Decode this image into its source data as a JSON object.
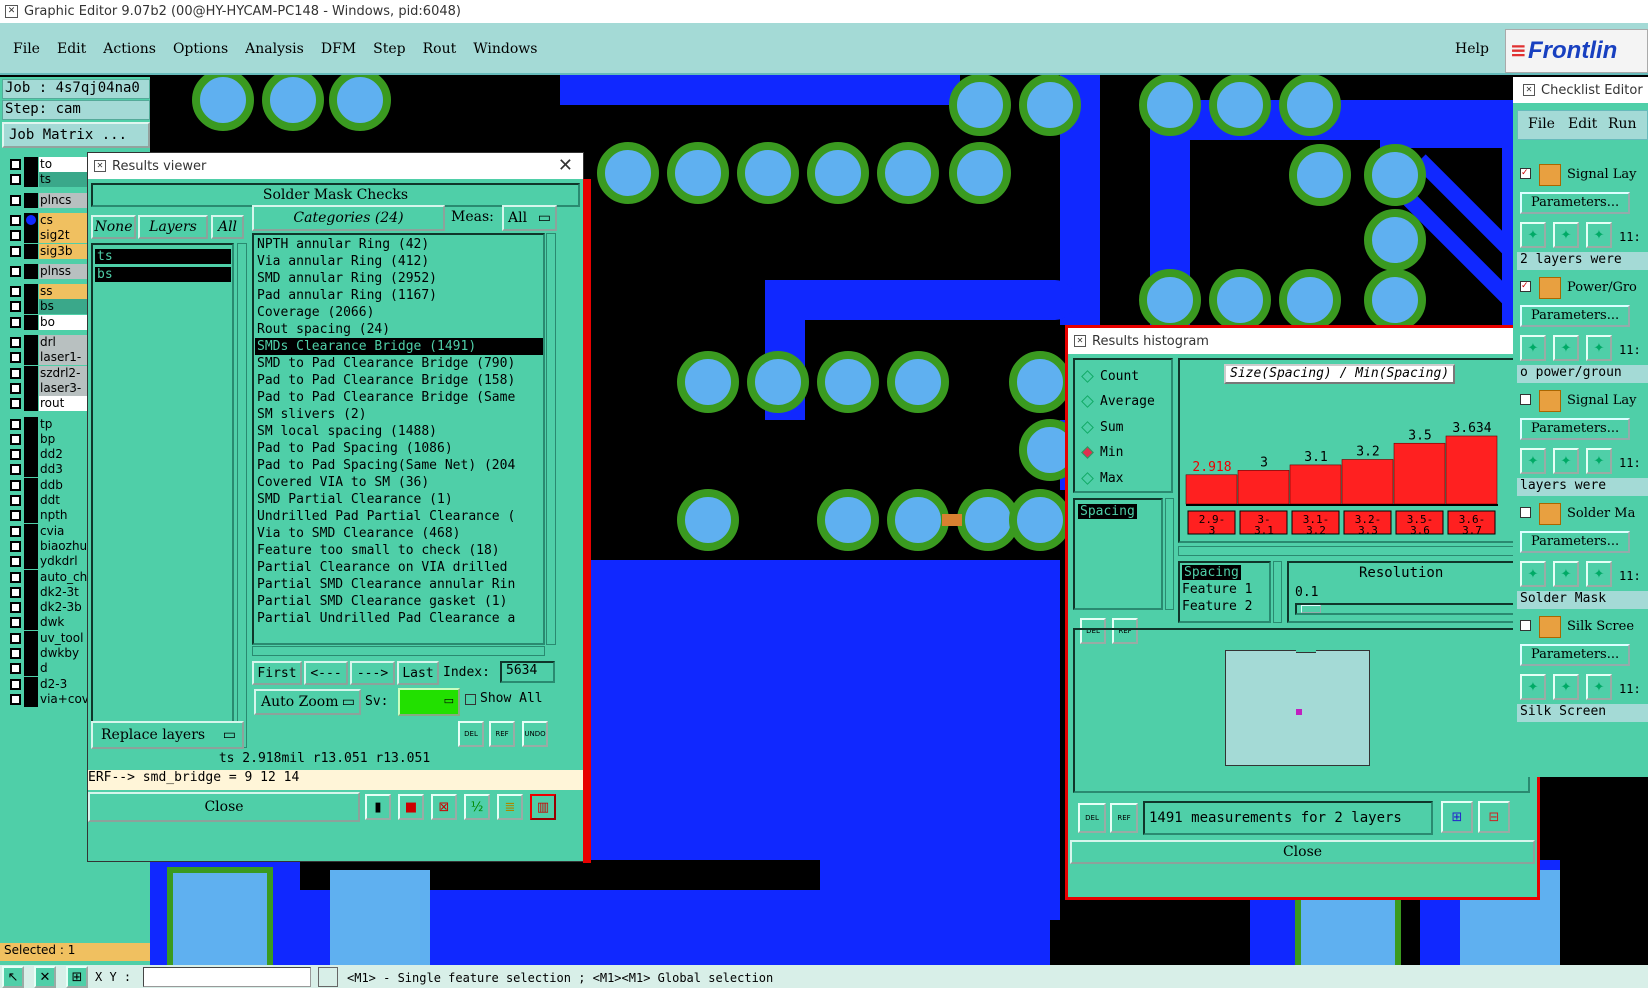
{
  "app": {
    "title": "Graphic Editor 9.07b2 (00@HY-HYCAM-PC148 - Windows, pid:6048)",
    "menu": [
      "File",
      "Edit",
      "Actions",
      "Options",
      "Analysis",
      "DFM",
      "Step",
      "Rout",
      "Windows"
    ],
    "help": "Help",
    "logo": "Frontlin"
  },
  "left_panel": {
    "job": "Job : 4s7qj04na0",
    "step": "Step: cam",
    "job_matrix": "Job Matrix ...",
    "selected": "Selected : 1",
    "xy_label": "X Y :",
    "layers": [
      {
        "name": "to",
        "bg": "#ffffff"
      },
      {
        "name": "ts",
        "bg": "#3aa88a"
      },
      {
        "name": "plncs",
        "bg": "#b8c0c0"
      },
      {
        "name": "cs",
        "bg": "#f0c060"
      },
      {
        "name": "sig2t",
        "bg": "#f0c060"
      },
      {
        "name": "sig3b",
        "bg": "#f0c060"
      },
      {
        "name": "plnss",
        "bg": "#b8c0c0"
      },
      {
        "name": "ss",
        "bg": "#f0c060"
      },
      {
        "name": "bs",
        "bg": "#3aa88a"
      },
      {
        "name": "bo",
        "bg": "#ffffff"
      },
      {
        "name": "drl",
        "bg": "#b8c0c0"
      },
      {
        "name": "laser1-",
        "bg": "#b8c0c0"
      },
      {
        "name": "szdrl2-",
        "bg": "#b8c0c0"
      },
      {
        "name": "laser3-",
        "bg": "#b8c0c0"
      },
      {
        "name": "rout",
        "bg": "#ffffff"
      },
      {
        "name": "tp",
        "bg": "#4fcfa8"
      },
      {
        "name": "bp",
        "bg": "#4fcfa8"
      },
      {
        "name": "dd2",
        "bg": "#4fcfa8"
      },
      {
        "name": "dd3",
        "bg": "#4fcfa8"
      },
      {
        "name": "ddb",
        "bg": "#4fcfa8"
      },
      {
        "name": "ddt",
        "bg": "#4fcfa8"
      },
      {
        "name": "npth",
        "bg": "#4fcfa8"
      },
      {
        "name": "cvia",
        "bg": "#4fcfa8"
      },
      {
        "name": "biaozhu",
        "bg": "#4fcfa8"
      },
      {
        "name": "ydkdrl",
        "bg": "#4fcfa8"
      },
      {
        "name": "auto_ch",
        "bg": "#4fcfa8"
      },
      {
        "name": "dk2-3t",
        "bg": "#4fcfa8"
      },
      {
        "name": "dk2-3b",
        "bg": "#4fcfa8"
      },
      {
        "name": "dwk",
        "bg": "#4fcfa8"
      },
      {
        "name": "uv_tool",
        "bg": "#4fcfa8"
      },
      {
        "name": "dwkby",
        "bg": "#4fcfa8"
      },
      {
        "name": "d",
        "bg": "#4fcfa8"
      },
      {
        "name": "d2-3",
        "bg": "#4fcfa8"
      },
      {
        "name": "via+cov",
        "bg": "#4fcfa8"
      }
    ]
  },
  "status_bar": {
    "text": "<M1> - Single feature selection ; <M1><M1> Global selection"
  },
  "results_viewer": {
    "title": "Results viewer",
    "heading": "Solder Mask Checks",
    "none_btn": "None",
    "layers_label": "Layers",
    "all_btn": "All",
    "layer_items": [
      "ts",
      "bs"
    ],
    "categories_label": "Categories (24)",
    "meas_label": "Meas:",
    "meas_value": "All",
    "categories": [
      "NPTH annular Ring (42)",
      "Via annular Ring (412)",
      "SMD annular Ring (2952)",
      "Pad annular Ring (1167)",
      "Coverage (2066)",
      "Rout spacing (24)",
      "SMDs Clearance Bridge (1491)",
      "SMD to Pad Clearance Bridge (790)",
      "Pad to Pad Clearance Bridge (158)",
      "Pad to Pad Clearance Bridge (Same",
      "SM slivers (2)",
      "SM local spacing (1488)",
      "Pad to Pad Spacing (1086)",
      "Pad to Pad Spacing(Same Net) (204",
      "Covered VIA to SM (36)",
      "SMD Partial Clearance (1)",
      "Undrilled Pad Partial Clearance (",
      "Via to SMD Clearance (468)",
      "Feature too small to check (18)",
      "Partial Clearance on VIA drilled",
      "Partial SMD Clearance annular Rin",
      "Partial SMD Clearance gasket (1)",
      "Partial Undrilled Pad Clearance a"
    ],
    "selected_category_index": 6,
    "first_btn": "First",
    "prev_btn": "<---",
    "next_btn": "--->",
    "last_btn": "Last",
    "index_label": "Index:",
    "index_value": "5634",
    "auto_zoom": "Auto Zoom",
    "sv_label": "Sv:",
    "show_all": "Show All",
    "replace_layers": "Replace layers",
    "info_line": "ts 2.918mil   r13.051   r13.051",
    "erf_line": "ERF--> smd_bridge = 9 12 14",
    "close": "Close"
  },
  "results_histogram": {
    "title": "Results histogram",
    "modes": [
      "Count",
      "Average",
      "Sum",
      "Min",
      "Max"
    ],
    "selected_mode": "Min",
    "list_item": "Spacing",
    "chart_title": "Size(Spacing) / Min(Spacing)",
    "attr_list": [
      "Spacing",
      "Feature 1",
      "Feature 2"
    ],
    "resolution_label": "Resolution",
    "resolution_value": "0.1",
    "summary": "1491 measurements for 2 layers",
    "close": "Close"
  },
  "chart_data": {
    "type": "bar",
    "title": "Size(Spacing) / Min(Spacing)",
    "categories": [
      "2.9-3",
      "3-3.1",
      "3.1-3.2",
      "3.2-3.3",
      "3.5-3.6",
      "3.6-3.7"
    ],
    "values": [
      2.918,
      3,
      3.1,
      3.2,
      3.5,
      3.634
    ],
    "value_labels": [
      "2.918",
      "3",
      "3.1",
      "3.2",
      "3.5",
      "3.634"
    ],
    "bar_color": "#ff2020"
  },
  "checklist_editor": {
    "title": "Checklist Editor",
    "menu": [
      "File",
      "Edit",
      "Run"
    ],
    "items": [
      {
        "name": "Signal Lay",
        "params": "Parameters...",
        "msg": "2 layers were"
      },
      {
        "name": "Power/Gro",
        "params": "Parameters...",
        "msg": "o power/groun"
      },
      {
        "name": "Signal Lay",
        "params": "Parameters...",
        "msg": "layers were"
      },
      {
        "name": "Solder Ma",
        "params": "Parameters...",
        "msg": "Solder Mask"
      },
      {
        "name": "Silk Scree",
        "params": "Parameters...",
        "msg": "Silk Screen"
      }
    ],
    "time_label": "11:"
  }
}
